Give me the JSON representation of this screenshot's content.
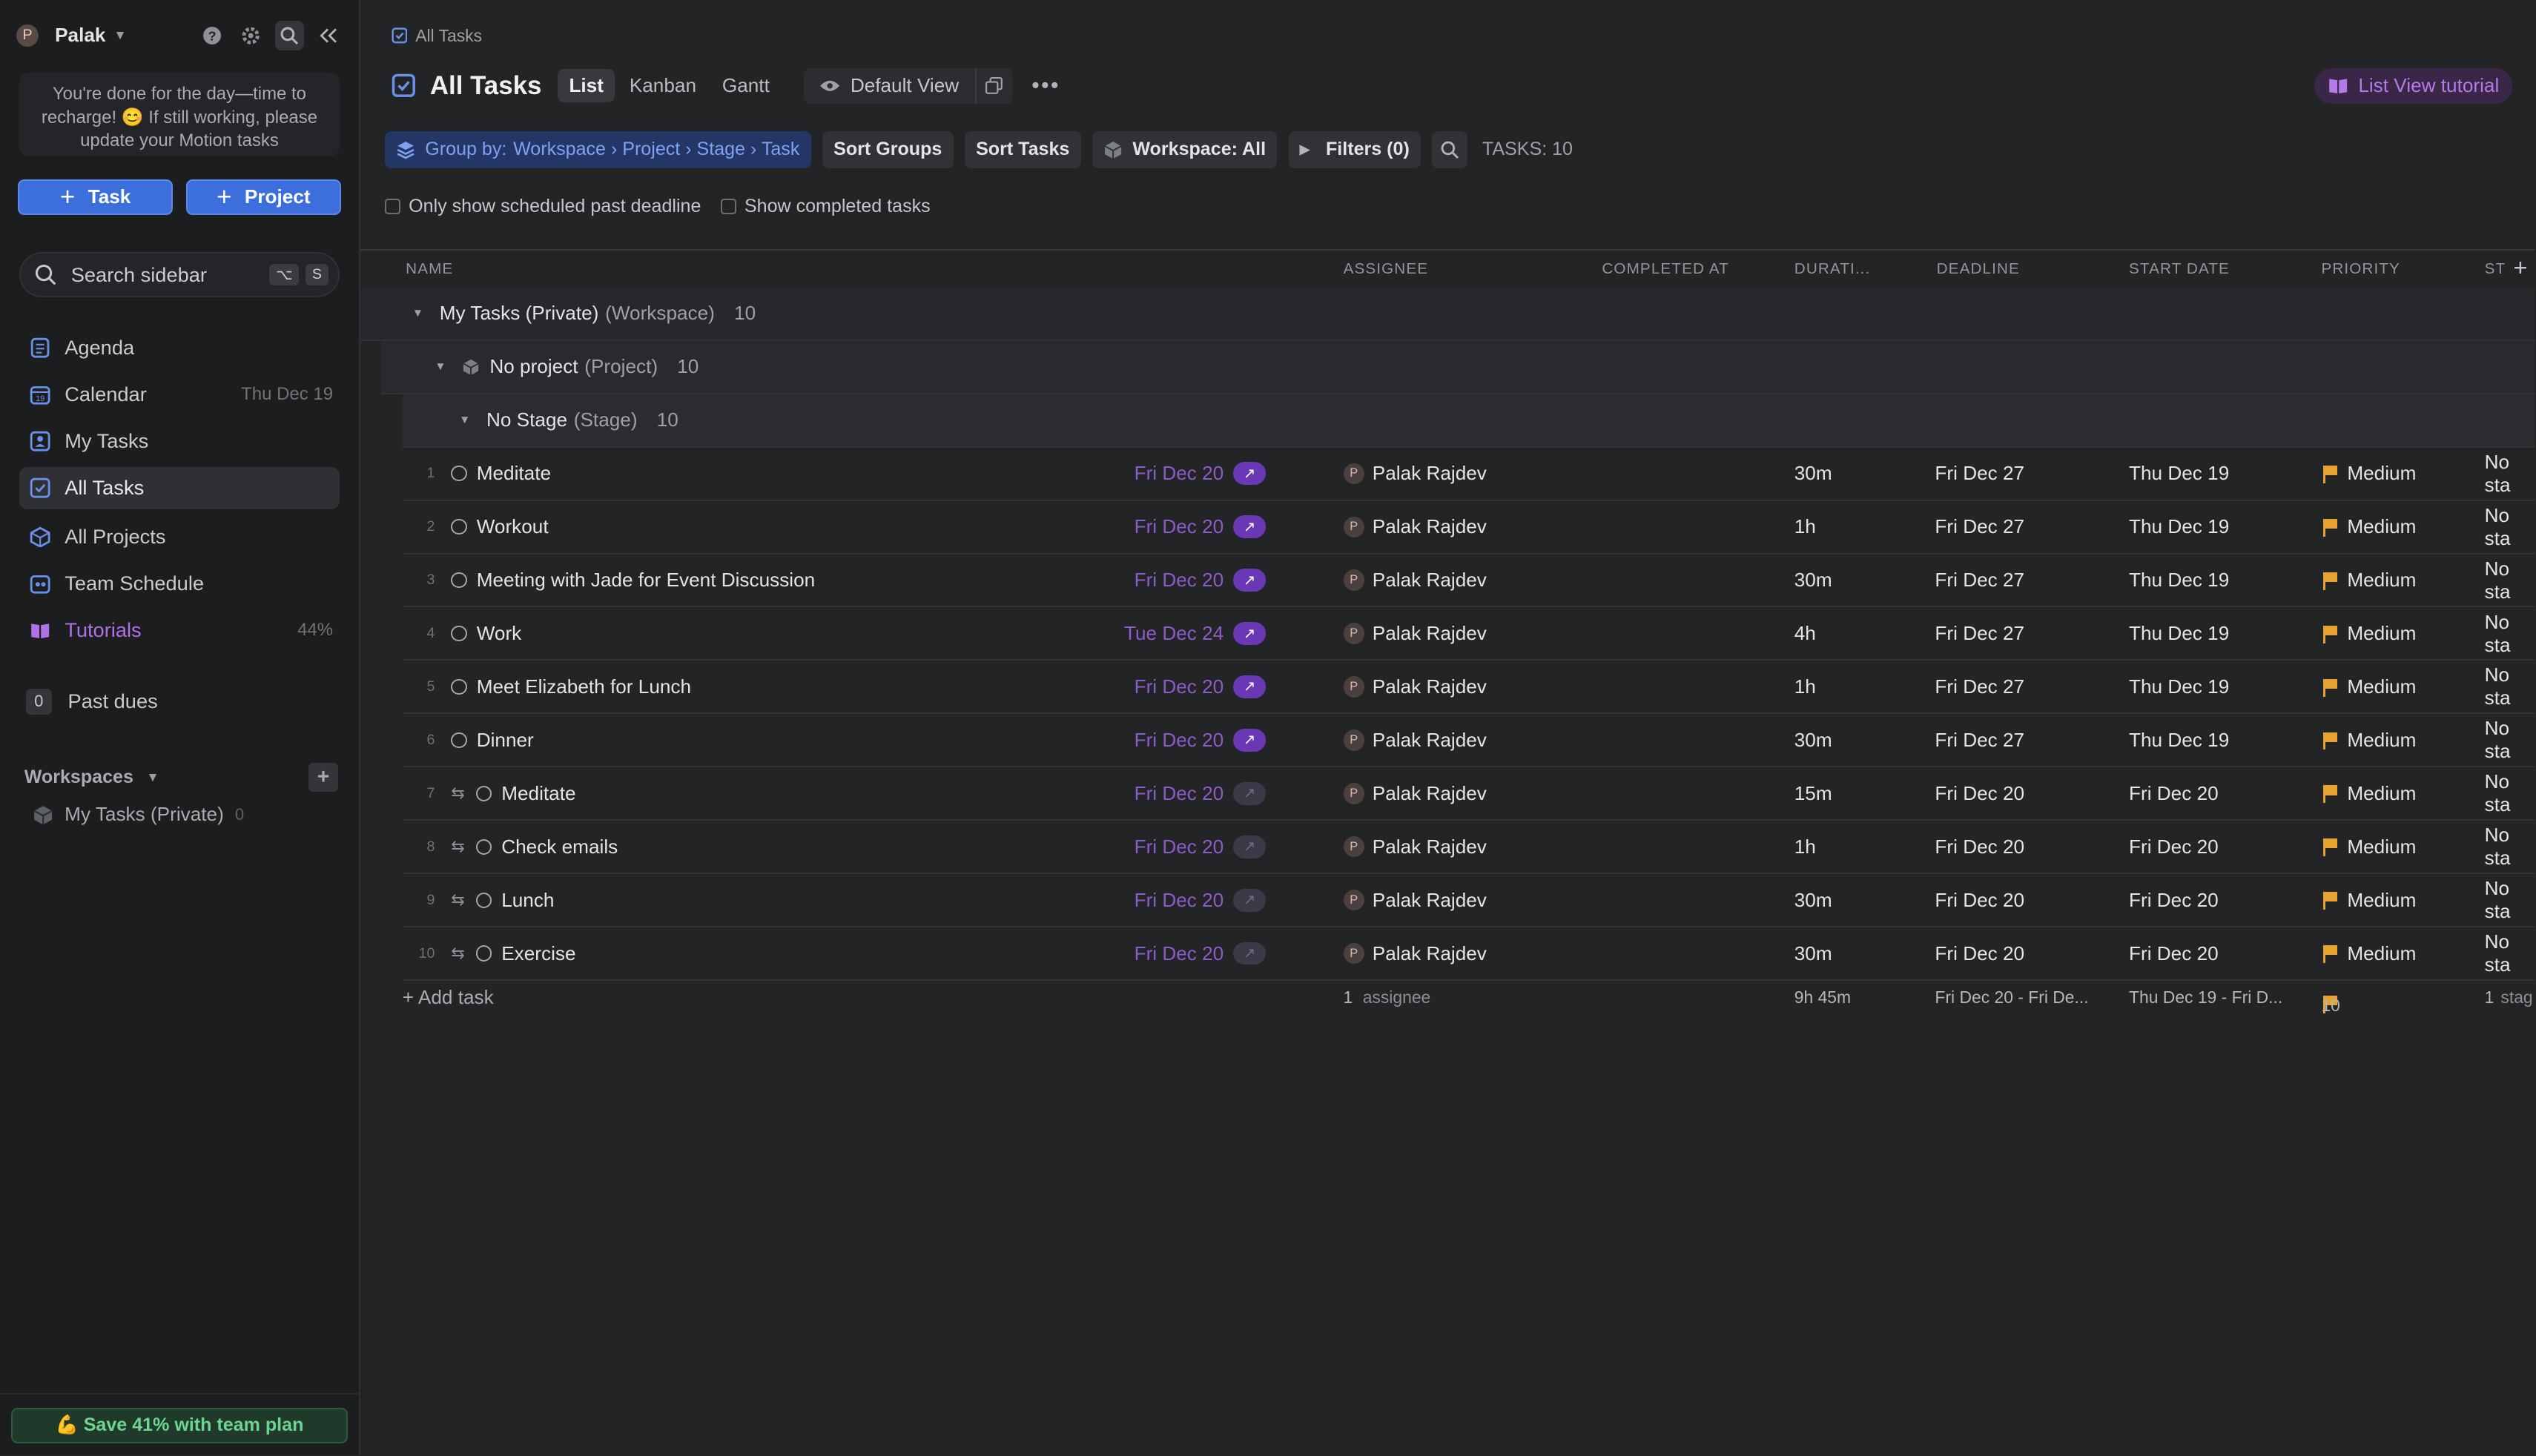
{
  "sidebar": {
    "user_initial": "P",
    "user_name": "Palak",
    "notice": "You're done for the day—time to recharge! 😊 If still working, please update your Motion tasks",
    "btn_task": "Task",
    "btn_project": "Project",
    "search_placeholder": "Search sidebar",
    "search_kbd1": "⌥",
    "search_kbd2": "S",
    "nav": [
      {
        "label": "Agenda",
        "meta": ""
      },
      {
        "label": "Calendar",
        "meta": "Thu Dec 19"
      },
      {
        "label": "My Tasks",
        "meta": ""
      },
      {
        "label": "All Tasks",
        "meta": ""
      },
      {
        "label": "All Projects",
        "meta": ""
      },
      {
        "label": "Team Schedule",
        "meta": ""
      },
      {
        "label": "Tutorials",
        "meta": "44%"
      }
    ],
    "past_dues_count": "0",
    "past_dues_label": "Past dues",
    "workspaces_label": "Workspaces",
    "workspace_item": "My Tasks (Private)",
    "workspace_count": "0",
    "upgrade": "💪 Save 41% with team plan"
  },
  "main": {
    "breadcrumb": "All Tasks",
    "title": "All Tasks",
    "tabs": [
      "List",
      "Kanban",
      "Gantt"
    ],
    "view": "Default View",
    "tutorial": "List View tutorial",
    "toolbar": {
      "group_prefix": "Group by:",
      "group_path": "Workspace › Project › Stage › Task",
      "sort_groups": "Sort Groups",
      "sort_tasks": "Sort Tasks",
      "workspace": "Workspace: All",
      "filters": "Filters (0)",
      "task_count": "TASKS: 10"
    },
    "checks": [
      "Only show scheduled past deadline",
      "Show completed tasks"
    ],
    "columns": [
      "NAME",
      "ASSIGNEE",
      "COMPLETED AT",
      "DURATI...",
      "DEADLINE",
      "START DATE",
      "PRIORITY",
      "ST"
    ],
    "groups": {
      "workspace": {
        "name": "My Tasks (Private)",
        "kind": "(Workspace)",
        "count": "10"
      },
      "project": {
        "name": "No project",
        "kind": "(Project)",
        "count": "10"
      },
      "stage": {
        "name": "No Stage",
        "kind": "(Stage)",
        "count": "10"
      }
    },
    "rows": [
      {
        "num": "1",
        "name": "Meditate",
        "due": "Fri Dec 20",
        "assignee": "Palak Rajdev",
        "duration": "30m",
        "deadline": "Fri Dec 27",
        "start": "Thu Dec 19",
        "priority": "Medium",
        "status": "No sta"
      },
      {
        "num": "2",
        "name": "Workout",
        "due": "Fri Dec 20",
        "assignee": "Palak Rajdev",
        "duration": "1h",
        "deadline": "Fri Dec 27",
        "start": "Thu Dec 19",
        "priority": "Medium",
        "status": "No sta"
      },
      {
        "num": "3",
        "name": "Meeting with Jade for Event Discussion",
        "due": "Fri Dec 20",
        "assignee": "Palak Rajdev",
        "duration": "30m",
        "deadline": "Fri Dec 27",
        "start": "Thu Dec 19",
        "priority": "Medium",
        "status": "No sta"
      },
      {
        "num": "4",
        "name": "Work",
        "due": "Tue Dec 24",
        "assignee": "Palak Rajdev",
        "duration": "4h",
        "deadline": "Fri Dec 27",
        "start": "Thu Dec 19",
        "priority": "Medium",
        "status": "No sta"
      },
      {
        "num": "5",
        "name": "Meet Elizabeth for Lunch",
        "due": "Fri Dec 20",
        "assignee": "Palak Rajdev",
        "duration": "1h",
        "deadline": "Fri Dec 27",
        "start": "Thu Dec 19",
        "priority": "Medium",
        "status": "No sta"
      },
      {
        "num": "6",
        "name": "Dinner",
        "due": "Fri Dec 20",
        "assignee": "Palak Rajdev",
        "duration": "30m",
        "deadline": "Fri Dec 27",
        "start": "Thu Dec 19",
        "priority": "Medium",
        "status": "No sta"
      },
      {
        "num": "7",
        "name": "Meditate",
        "due": "Fri Dec 20",
        "assignee": "Palak Rajdev",
        "duration": "15m",
        "deadline": "Fri Dec 20",
        "start": "Fri Dec 20",
        "priority": "Medium",
        "status": "No sta"
      },
      {
        "num": "8",
        "name": "Check emails",
        "due": "Fri Dec 20",
        "assignee": "Palak Rajdev",
        "duration": "1h",
        "deadline": "Fri Dec 20",
        "start": "Fri Dec 20",
        "priority": "Medium",
        "status": "No sta"
      },
      {
        "num": "9",
        "name": "Lunch",
        "due": "Fri Dec 20",
        "assignee": "Palak Rajdev",
        "duration": "30m",
        "deadline": "Fri Dec 20",
        "start": "Fri Dec 20",
        "priority": "Medium",
        "status": "No sta"
      },
      {
        "num": "10",
        "name": "Exercise",
        "due": "Fri Dec 20",
        "assignee": "Palak Rajdev",
        "duration": "30m",
        "deadline": "Fri Dec 20",
        "start": "Fri Dec 20",
        "priority": "Medium",
        "status": "No sta"
      }
    ],
    "footer": {
      "add_task": "+ Add task",
      "assignee_count": "1",
      "assignee_label": "assignee",
      "duration_total": "9h 45m",
      "deadline_range": "Fri Dec 20 - Fri De...",
      "start_range": "Thu Dec 19 - Fri D...",
      "priority_count": "10",
      "stage_count": "1",
      "stage_label": "stag"
    }
  },
  "colors": {
    "accent": "#3d6fdc",
    "purple": "#8d5bcb",
    "flag": "#e8a22f"
  }
}
